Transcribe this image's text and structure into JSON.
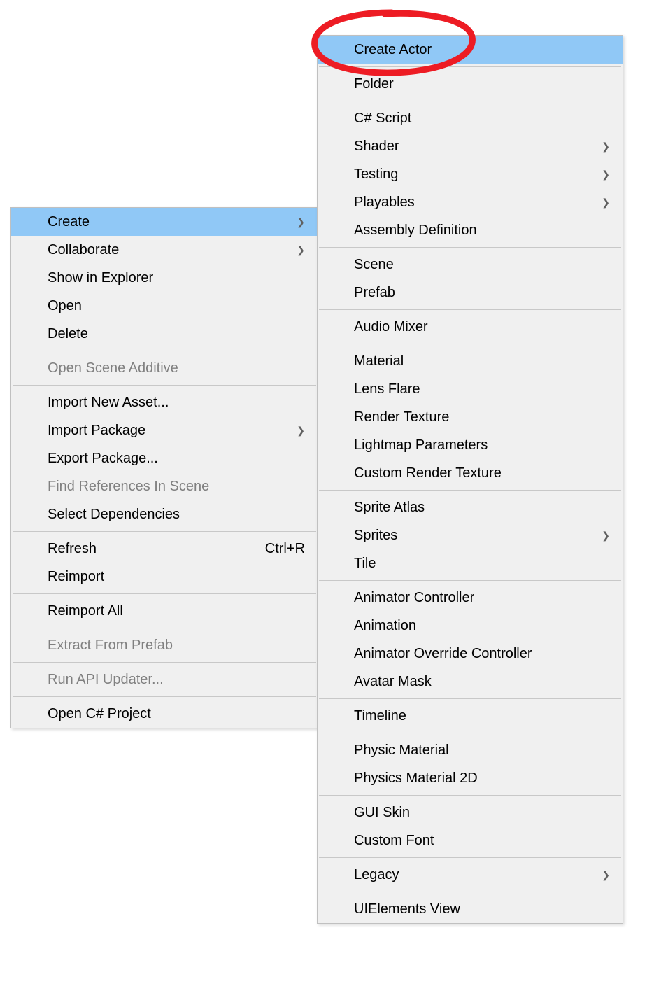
{
  "leftMenu": {
    "groups": [
      [
        {
          "label": "Create",
          "hasSubmenu": true,
          "highlighted": true
        },
        {
          "label": "Collaborate",
          "hasSubmenu": true
        },
        {
          "label": "Show in Explorer"
        },
        {
          "label": "Open"
        },
        {
          "label": "Delete"
        }
      ],
      [
        {
          "label": "Open Scene Additive",
          "disabled": true
        }
      ],
      [
        {
          "label": "Import New Asset..."
        },
        {
          "label": "Import Package",
          "hasSubmenu": true
        },
        {
          "label": "Export Package..."
        },
        {
          "label": "Find References In Scene",
          "disabled": true
        },
        {
          "label": "Select Dependencies"
        }
      ],
      [
        {
          "label": "Refresh",
          "shortcut": "Ctrl+R"
        },
        {
          "label": "Reimport"
        }
      ],
      [
        {
          "label": "Reimport All"
        }
      ],
      [
        {
          "label": "Extract From Prefab",
          "disabled": true
        }
      ],
      [
        {
          "label": "Run API Updater...",
          "disabled": true
        }
      ],
      [
        {
          "label": "Open C# Project"
        }
      ]
    ]
  },
  "rightMenu": {
    "groups": [
      [
        {
          "label": "Create Actor",
          "highlighted": true
        }
      ],
      [
        {
          "label": "Folder"
        }
      ],
      [
        {
          "label": "C# Script"
        },
        {
          "label": "Shader",
          "hasSubmenu": true
        },
        {
          "label": "Testing",
          "hasSubmenu": true
        },
        {
          "label": "Playables",
          "hasSubmenu": true
        },
        {
          "label": "Assembly Definition"
        }
      ],
      [
        {
          "label": "Scene"
        },
        {
          "label": "Prefab"
        }
      ],
      [
        {
          "label": "Audio Mixer"
        }
      ],
      [
        {
          "label": "Material"
        },
        {
          "label": "Lens Flare"
        },
        {
          "label": "Render Texture"
        },
        {
          "label": "Lightmap Parameters"
        },
        {
          "label": "Custom Render Texture"
        }
      ],
      [
        {
          "label": "Sprite Atlas"
        },
        {
          "label": "Sprites",
          "hasSubmenu": true
        },
        {
          "label": "Tile"
        }
      ],
      [
        {
          "label": "Animator Controller"
        },
        {
          "label": "Animation"
        },
        {
          "label": "Animator Override Controller"
        },
        {
          "label": "Avatar Mask"
        }
      ],
      [
        {
          "label": "Timeline"
        }
      ],
      [
        {
          "label": "Physic Material"
        },
        {
          "label": "Physics Material 2D"
        }
      ],
      [
        {
          "label": "GUI Skin"
        },
        {
          "label": "Custom Font"
        }
      ],
      [
        {
          "label": "Legacy",
          "hasSubmenu": true
        }
      ],
      [
        {
          "label": "UIElements View"
        }
      ]
    ]
  },
  "arrowGlyph": "❯"
}
